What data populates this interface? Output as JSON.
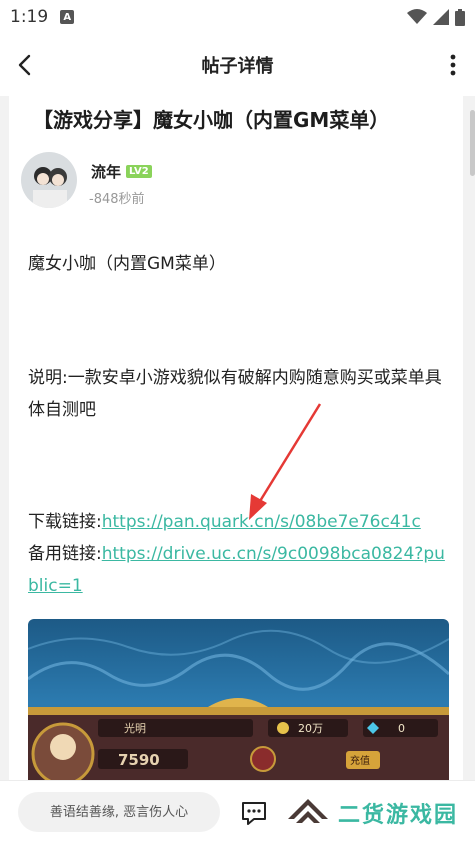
{
  "status_bar": {
    "time": "1:19",
    "app_icon_letter": "A"
  },
  "nav": {
    "title": "帖子详情"
  },
  "post": {
    "title": "【游戏分享】魔女小咖（内置GM菜单）",
    "author": {
      "name": "流年",
      "level": "LV2"
    },
    "time_ago": "-848秒前",
    "paragraph1": "魔女小咖（内置GM菜单）",
    "paragraph2": "说明:一款安卓小游戏貌似有破解内购随意购买或菜单具体自测吧",
    "download_label": "下载链接:",
    "download_url": "https://pan.quark.cn/s/08be7e76c41c",
    "backup_label": "备用链接:",
    "backup_url": "https://drive.uc.cn/s/9c0098bca0824?public=1",
    "screenshot_game": {
      "player_name": "光明",
      "gold": "20万",
      "gems": "0",
      "power": "7590",
      "recharge": "充值"
    }
  },
  "bottom_bar": {
    "comment_placeholder": "善语结善缘, 恶言伤人心",
    "brand_text": "二货游戏园"
  },
  "colors": {
    "accent": "#3bb8a2",
    "arrow": "#e53935"
  }
}
